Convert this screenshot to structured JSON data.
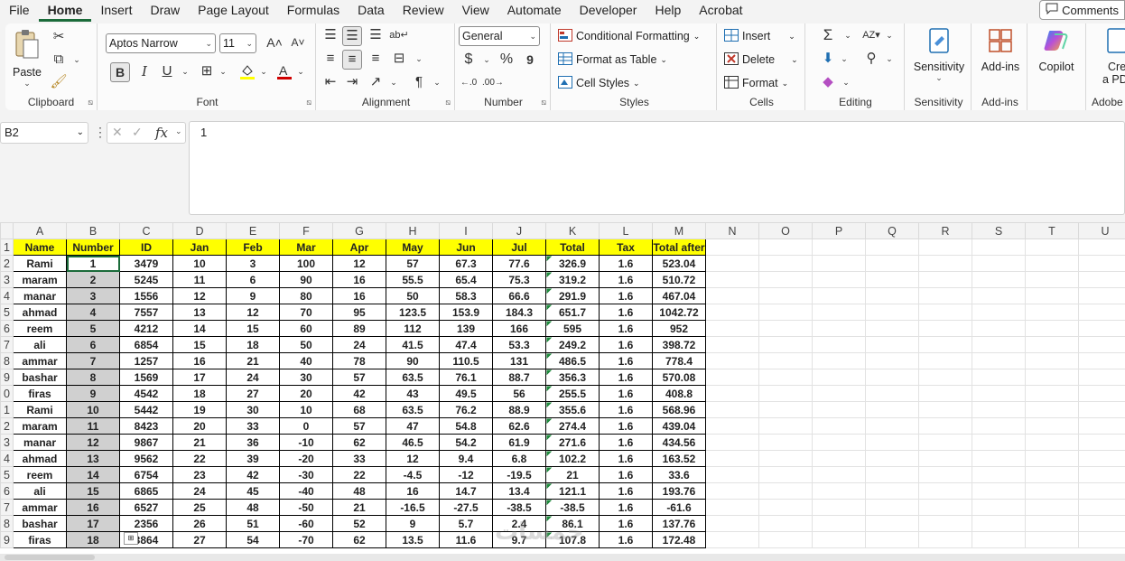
{
  "menu": [
    "File",
    "Home",
    "Insert",
    "Draw",
    "Page Layout",
    "Formulas",
    "Data",
    "Review",
    "View",
    "Automate",
    "Developer",
    "Help",
    "Acrobat"
  ],
  "menu_active": "Home",
  "comments_label": "Comments",
  "ribbon": {
    "clipboard": {
      "label": "Clipboard",
      "paste": "Paste"
    },
    "font": {
      "label": "Font",
      "font_name": "Aptos Narrow",
      "font_size": "11",
      "bold": "B",
      "italic": "I",
      "underline": "U"
    },
    "alignment": {
      "label": "Alignment"
    },
    "number": {
      "label": "Number",
      "format": "General",
      "currency": "$",
      "percent": "%",
      "comma": "9"
    },
    "styles": {
      "label": "Styles",
      "conditional": "Conditional Formatting",
      "format_table": "Format as Table",
      "cell_styles": "Cell Styles"
    },
    "cells": {
      "label": "Cells",
      "insert": "Insert",
      "delete": "Delete",
      "format": "Format"
    },
    "editing": {
      "label": "Editing"
    },
    "sensitivity": {
      "label": "Sensitivity",
      "button": "Sensitivity"
    },
    "addins": {
      "label": "Add-ins",
      "button": "Add-ins"
    },
    "copilot": {
      "button": "Copilot"
    },
    "acrobat": {
      "label": "Adobe A",
      "button_line1": "Crea",
      "button_line2": "a PD"
    }
  },
  "formula_bar": {
    "name_box": "B2",
    "fx": "fx",
    "value": "1"
  },
  "columns": [
    "A",
    "B",
    "C",
    "D",
    "E",
    "F",
    "G",
    "H",
    "I",
    "J",
    "K",
    "L",
    "M",
    "N",
    "O",
    "P",
    "Q",
    "R",
    "S",
    "T",
    "U"
  ],
  "headers": [
    "Name",
    "Number",
    "ID",
    "Jan",
    "Feb",
    "Mar",
    "Apr",
    "May",
    "Jun",
    "Jul",
    "Total",
    "Tax",
    "Total after"
  ],
  "rows": [
    [
      "Rami",
      "1",
      "3479",
      "10",
      "3",
      "100",
      "12",
      "57",
      "67.3",
      "77.6",
      "326.9",
      "1.6",
      "523.04"
    ],
    [
      "maram",
      "2",
      "5245",
      "11",
      "6",
      "90",
      "16",
      "55.5",
      "65.4",
      "75.3",
      "319.2",
      "1.6",
      "510.72"
    ],
    [
      "manar",
      "3",
      "1556",
      "12",
      "9",
      "80",
      "16",
      "50",
      "58.3",
      "66.6",
      "291.9",
      "1.6",
      "467.04"
    ],
    [
      "ahmad",
      "4",
      "7557",
      "13",
      "12",
      "70",
      "95",
      "123.5",
      "153.9",
      "184.3",
      "651.7",
      "1.6",
      "1042.72"
    ],
    [
      "reem",
      "5",
      "4212",
      "14",
      "15",
      "60",
      "89",
      "112",
      "139",
      "166",
      "595",
      "1.6",
      "952"
    ],
    [
      "ali",
      "6",
      "6854",
      "15",
      "18",
      "50",
      "24",
      "41.5",
      "47.4",
      "53.3",
      "249.2",
      "1.6",
      "398.72"
    ],
    [
      "ammar",
      "7",
      "1257",
      "16",
      "21",
      "40",
      "78",
      "90",
      "110.5",
      "131",
      "486.5",
      "1.6",
      "778.4"
    ],
    [
      "bashar",
      "8",
      "1569",
      "17",
      "24",
      "30",
      "57",
      "63.5",
      "76.1",
      "88.7",
      "356.3",
      "1.6",
      "570.08"
    ],
    [
      "firas",
      "9",
      "4542",
      "18",
      "27",
      "20",
      "42",
      "43",
      "49.5",
      "56",
      "255.5",
      "1.6",
      "408.8"
    ],
    [
      "Rami",
      "10",
      "5442",
      "19",
      "30",
      "10",
      "68",
      "63.5",
      "76.2",
      "88.9",
      "355.6",
      "1.6",
      "568.96"
    ],
    [
      "maram",
      "11",
      "8423",
      "20",
      "33",
      "0",
      "57",
      "47",
      "54.8",
      "62.6",
      "274.4",
      "1.6",
      "439.04"
    ],
    [
      "manar",
      "12",
      "9867",
      "21",
      "36",
      "-10",
      "62",
      "46.5",
      "54.2",
      "61.9",
      "271.6",
      "1.6",
      "434.56"
    ],
    [
      "ahmad",
      "13",
      "9562",
      "22",
      "39",
      "-20",
      "33",
      "12",
      "9.4",
      "6.8",
      "102.2",
      "1.6",
      "163.52"
    ],
    [
      "reem",
      "14",
      "6754",
      "23",
      "42",
      "-30",
      "22",
      "-4.5",
      "-12",
      "-19.5",
      "21",
      "1.6",
      "33.6"
    ],
    [
      "ali",
      "15",
      "6865",
      "24",
      "45",
      "-40",
      "48",
      "16",
      "14.7",
      "13.4",
      "121.1",
      "1.6",
      "193.76"
    ],
    [
      "ammar",
      "16",
      "6527",
      "25",
      "48",
      "-50",
      "21",
      "-16.5",
      "-27.5",
      "-38.5",
      "-38.5",
      "1.6",
      "-61.6"
    ],
    [
      "bashar",
      "17",
      "2356",
      "26",
      "51",
      "-60",
      "52",
      "9",
      "5.7",
      "2.4",
      "86.1",
      "1.6",
      "137.76"
    ],
    [
      "firas",
      "18",
      "3864",
      "27",
      "54",
      "-70",
      "62",
      "13.5",
      "11.6",
      "9.7",
      "107.8",
      "1.6",
      "172.48"
    ]
  ],
  "watermark": "خمسات"
}
